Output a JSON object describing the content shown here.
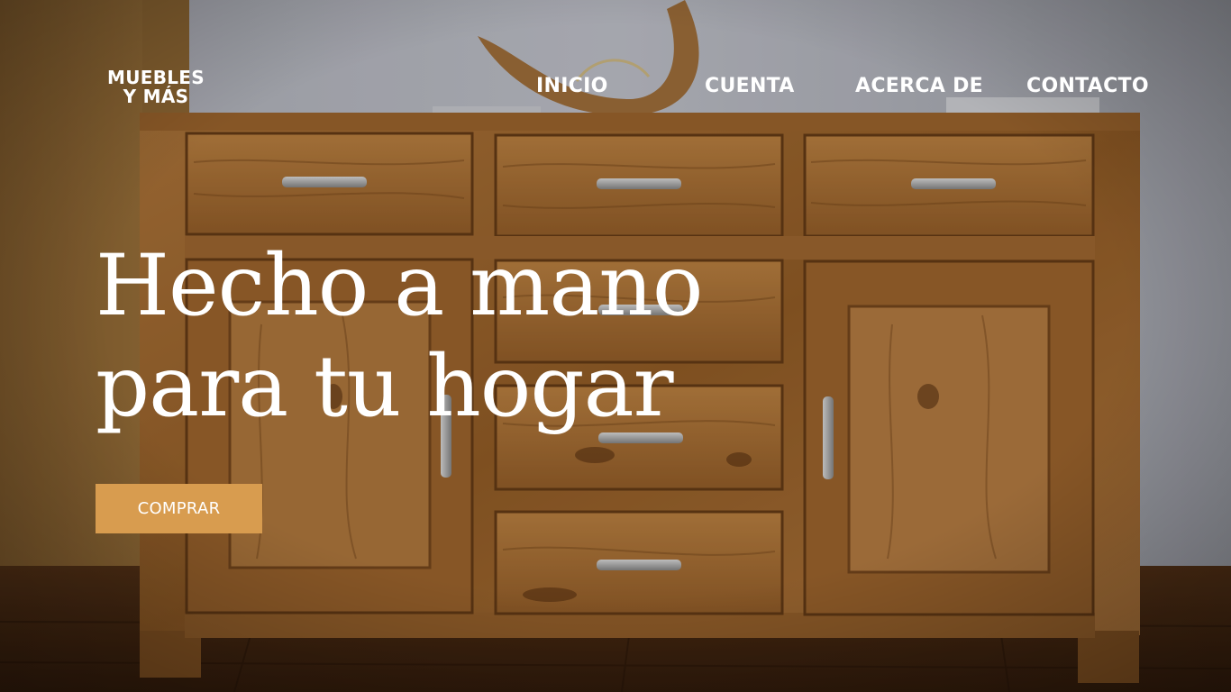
{
  "brand": {
    "line1": "MUEBLES",
    "line2": "Y MÁS"
  },
  "nav": {
    "items": [
      {
        "label": "INICIO"
      },
      {
        "label": "CUENTA"
      },
      {
        "label": "ACERCA DE"
      },
      {
        "label": "CONTACTO"
      }
    ]
  },
  "hero": {
    "title_line1": "Hecho a mano",
    "title_line2": "para tu hogar",
    "cta_label": "COMPRAR",
    "background_image": "wooden-sideboard-photo"
  },
  "colors": {
    "cta_background": "#d89c4f",
    "text": "#ffffff",
    "wood_base": "#8a5a2b",
    "wall": "#c9cbd3"
  }
}
